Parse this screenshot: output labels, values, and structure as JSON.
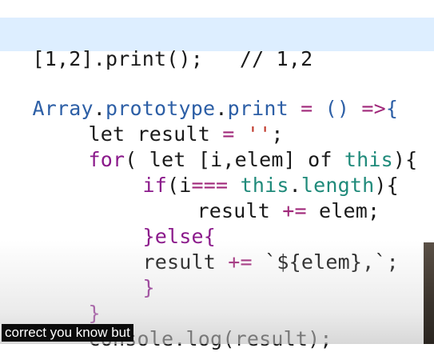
{
  "example": {
    "call": "[1,2].print();",
    "comment": "// 1,2"
  },
  "code": {
    "l1": {
      "obj": "Array",
      "dot1": ".",
      "proto": "prototype",
      "dot2": ".",
      "method": "print",
      "eq": " = ",
      "params": "() ",
      "arrow": "=>",
      "brace": "{"
    },
    "l2": {
      "kw": "let",
      "name": " result ",
      "eq": "=",
      "space": " ",
      "str": "''",
      "semi": ";"
    },
    "l3": {
      "kw": "for",
      "open": "( ",
      "let": "let",
      "destructure": " [i,elem] ",
      "of": "of",
      "space": " ",
      "this": "this",
      "close": "){"
    },
    "l4": {
      "kw": "if",
      "open": "(i",
      "op": "===",
      "space": " ",
      "this": "this",
      "dot": ".",
      "prop": "length",
      "close": "){"
    },
    "l5": {
      "name": "result ",
      "op": "+=",
      "rest": " elem;"
    },
    "l6": {
      "close": "}",
      "kw": "else",
      "open": "{"
    },
    "l7": {
      "name": "result ",
      "op": "+=",
      "space": " ",
      "template": "`${elem},`",
      "semi": ";"
    },
    "l8": {
      "close": "}"
    },
    "l9": {
      "close": "}"
    },
    "l10": {
      "obj": "console",
      "dot": ".",
      "method": "log",
      "args": "(result);"
    }
  },
  "caption": "correct you know but"
}
